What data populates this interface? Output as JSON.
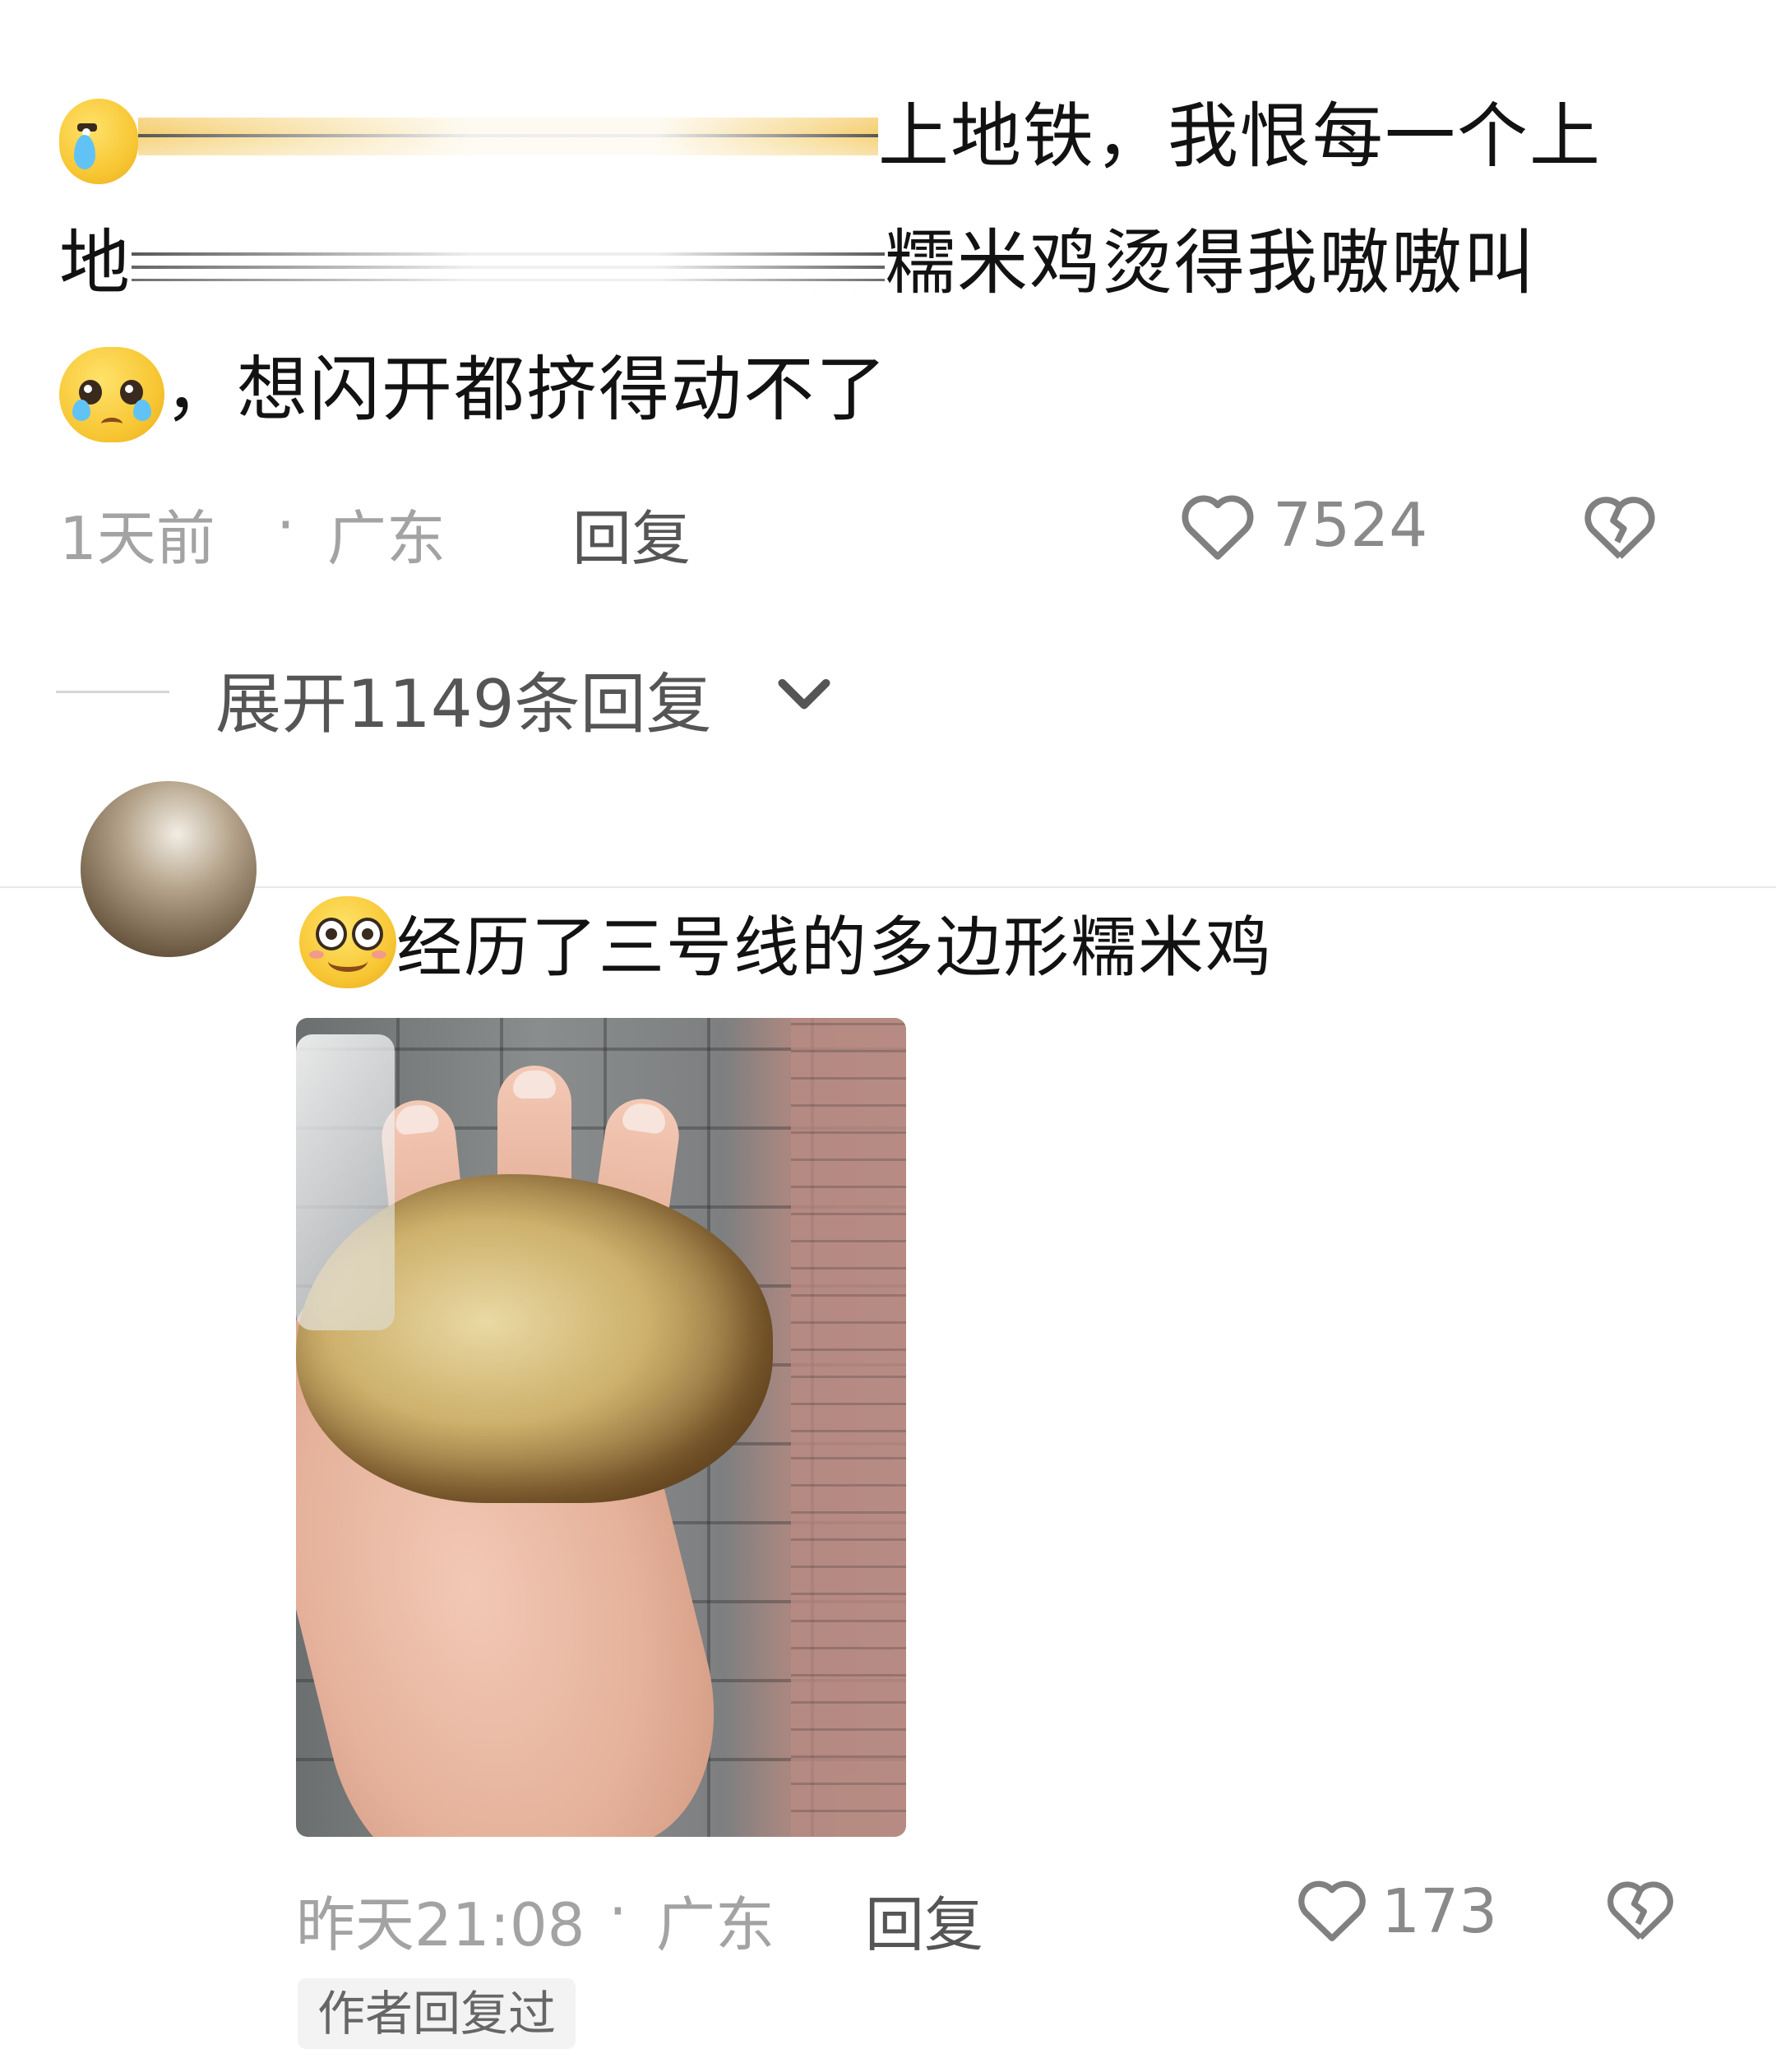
{
  "comment1": {
    "line1_text": "上地铁，我恨每一个上",
    "line2_prefix": "地",
    "line2_text": "糯米鸡烫得我嗷嗷叫",
    "line3_text": "，想闪开都挤得动不了",
    "time": "1天前",
    "separator": "·",
    "location": "广东",
    "reply_label": "回复",
    "like_count": "7524",
    "expand_label": "展开1149条回复"
  },
  "comment2": {
    "text": "经历了三号线的多边形糯米鸡",
    "time": "昨天21:08",
    "separator": "·",
    "location": "广东",
    "reply_label": "回复",
    "like_count": "173",
    "author_tag": "作者回复过"
  },
  "icons": {
    "like": "heart-outline-icon",
    "dislike": "broken-heart-icon",
    "expand": "chevron-down-icon"
  },
  "colors": {
    "text_primary": "#121212",
    "text_meta": "#a3a3a3",
    "reply": "#555555",
    "tag_bg": "#f3f3f3"
  }
}
